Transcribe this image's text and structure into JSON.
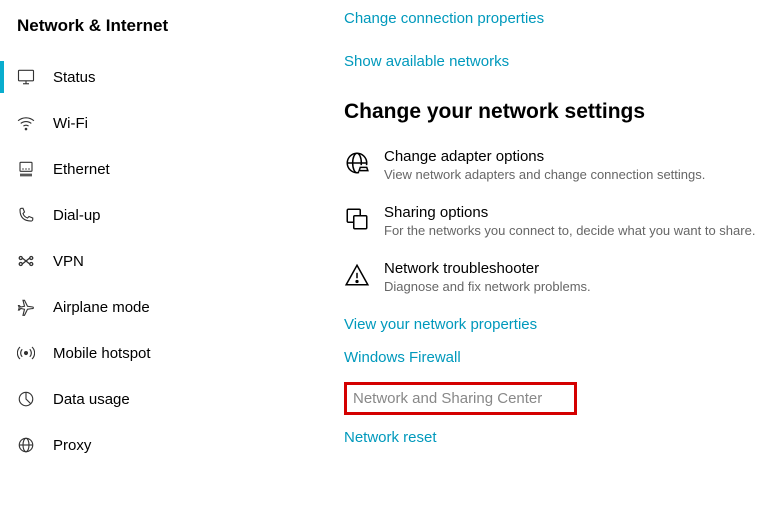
{
  "sidebar": {
    "title": "Network & Internet",
    "items": [
      {
        "label": "Status"
      },
      {
        "label": "Wi-Fi"
      },
      {
        "label": "Ethernet"
      },
      {
        "label": "Dial-up"
      },
      {
        "label": "VPN"
      },
      {
        "label": "Airplane mode"
      },
      {
        "label": "Mobile hotspot"
      },
      {
        "label": "Data usage"
      },
      {
        "label": "Proxy"
      }
    ]
  },
  "main": {
    "top_links": {
      "change_props": "Change connection properties",
      "show_networks": "Show available networks"
    },
    "section_heading": "Change your network settings",
    "settings": [
      {
        "title": "Change adapter options",
        "desc": "View network adapters and change connection settings."
      },
      {
        "title": "Sharing options",
        "desc": "For the networks you connect to, decide what you want to share."
      },
      {
        "title": "Network troubleshooter",
        "desc": "Diagnose and fix network problems."
      }
    ],
    "links": {
      "view_props": "View your network properties",
      "firewall": "Windows Firewall",
      "sharing_center": "Network and Sharing Center",
      "reset": "Network reset"
    }
  }
}
